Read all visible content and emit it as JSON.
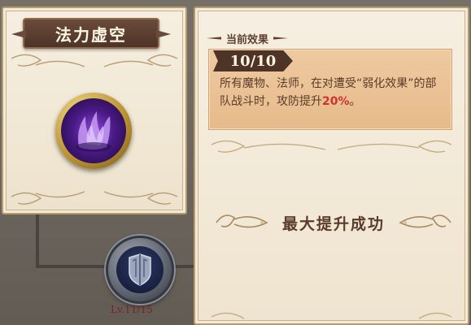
{
  "skill": {
    "title": "法力虚空",
    "icon": "purple-void-orb-icon",
    "upgrade_icon": "shield-badge-icon",
    "level_label": "Lv.11/15"
  },
  "effect_panel": {
    "header": "当前效果",
    "level": "10/10",
    "description_main": "所有魔物、法师，在对遭受“弱化效果”的部队战斗时，攻防提升",
    "description_highlight": "20%",
    "description_tail": "。",
    "max_message": "最大提升成功"
  },
  "colors": {
    "title_bg": "#4e3427",
    "parchment": "#f3ead8",
    "effect_box": "#e9c195",
    "highlight_red": "#d3312b",
    "level_text": "#7a2222"
  }
}
